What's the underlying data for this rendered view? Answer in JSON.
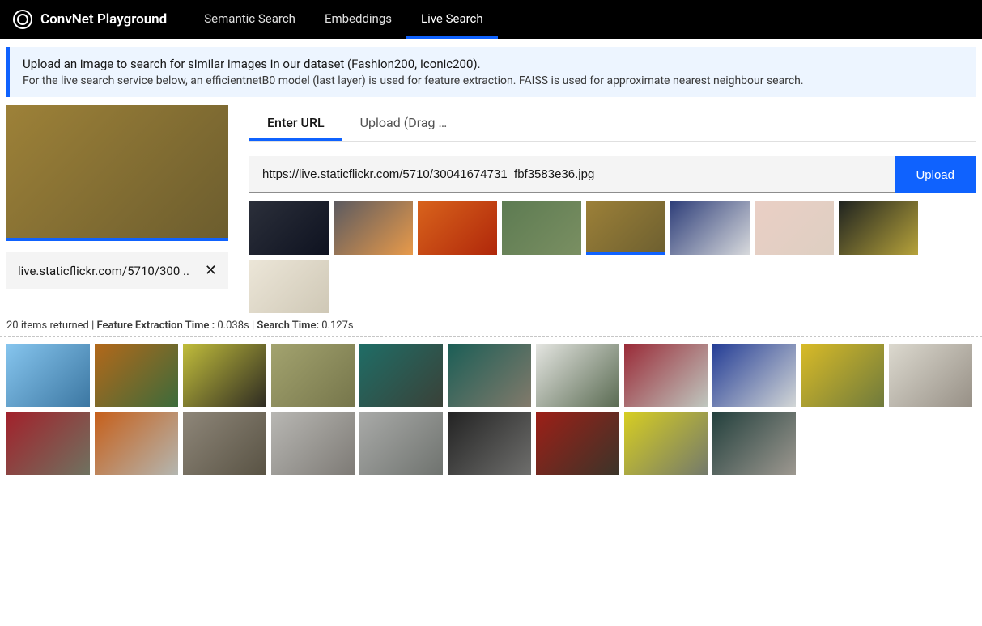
{
  "brand": "ConvNet Playground",
  "nav": {
    "items": [
      "Semantic Search",
      "Embeddings",
      "Live Search"
    ],
    "active_index": 2
  },
  "banner": {
    "line1": "Upload an image to search for similar images in our dataset (Fashion200, Iconic200).",
    "line2": "For the live search service below, an efficientnetB0 model (last layer) is used for feature extraction. FAISS is used for approximate nearest neighbour search."
  },
  "tabs": {
    "items": [
      "Enter URL",
      "Upload (Drag n Dr..."
    ],
    "active_index": 0
  },
  "url_input": {
    "value": "https://live.staticflickr.com/5710/30041674731_fbf3583e36.jpg",
    "button_label": "Upload"
  },
  "samples": [
    {
      "name": "eiffel-tower",
      "bg1": "#2b2f3a",
      "bg2": "#0e1220"
    },
    {
      "name": "stonehenge",
      "bg1": "#5b5a60",
      "bg2": "#e89a4a"
    },
    {
      "name": "orange-slices",
      "bg1": "#d8631c",
      "bg2": "#b0270a"
    },
    {
      "name": "red-car-road",
      "bg1": "#5d7b52",
      "bg2": "#7a8f62"
    },
    {
      "name": "vintage-car",
      "bg1": "#9c8038",
      "bg2": "#6e6030",
      "selected": true
    },
    {
      "name": "blue-dress",
      "bg1": "#2f3f7a",
      "bg2": "#d7d9dc"
    },
    {
      "name": "pink-flats",
      "bg1": "#eacfc5",
      "bg2": "#decfc2"
    },
    {
      "name": "black-sneakers",
      "bg1": "#1f2320",
      "bg2": "#b6a23a"
    },
    {
      "name": "grey-shoes",
      "bg1": "#ece6d8",
      "bg2": "#cfc8b6"
    }
  ],
  "query_image": {
    "name": "vintage-car",
    "bg1": "#9d8138",
    "bg2": "#6c5d2e"
  },
  "chip": {
    "text": "live.staticflickr.com/5710/300 .."
  },
  "stats": {
    "items_returned": "20 items returned",
    "extract_label": "Feature Extraction Time :",
    "extract_time": "0.038s",
    "search_label": "Search Time:",
    "search_time": "0.127s"
  },
  "results": [
    {
      "name": "blue-pickup-city",
      "bg1": "#86c5ee",
      "bg2": "#3c77a2"
    },
    {
      "name": "orange-beetle-park",
      "bg1": "#b3681a",
      "bg2": "#3c6b3b"
    },
    {
      "name": "yellow-beetle-show",
      "bg1": "#c1bd3b",
      "bg2": "#2e2b22"
    },
    {
      "name": "tan-beetle-field",
      "bg1": "#a3a36f",
      "bg2": "#76764b"
    },
    {
      "name": "teal-beetle-1",
      "bg1": "#1f6d66",
      "bg2": "#3a4138"
    },
    {
      "name": "teal-beetle-2",
      "bg1": "#1b5e56",
      "bg2": "#827a6b"
    },
    {
      "name": "white-pickup",
      "bg1": "#e4e5e1",
      "bg2": "#5a6b52"
    },
    {
      "name": "red-beetle",
      "bg1": "#9a2a37",
      "bg2": "#bfc7bf"
    },
    {
      "name": "blue-white-beetle",
      "bg1": "#243d96",
      "bg2": "#d2d6d6"
    },
    {
      "name": "yellow-beetle-grass",
      "bg1": "#d9bb27",
      "bg2": "#6f7a3c"
    },
    {
      "name": "white-beetle",
      "bg1": "#dcd9cf",
      "bg2": "#979086"
    },
    {
      "name": "red-beetle-street",
      "bg1": "#a2212b",
      "bg2": "#6f7260"
    },
    {
      "name": "orange-beetle-road",
      "bg1": "#c65f1a",
      "bg2": "#b4b6b0"
    },
    {
      "name": "grey-beetle-cobble",
      "bg1": "#8e8679",
      "bg2": "#595344"
    },
    {
      "name": "silver-sedan",
      "bg1": "#b8b7b3",
      "bg2": "#7e7b76"
    },
    {
      "name": "silver-pickup",
      "bg1": "#a9aaa8",
      "bg2": "#6f736f"
    },
    {
      "name": "black-car",
      "bg1": "#232323",
      "bg2": "#6e6e6c"
    },
    {
      "name": "red-pickup-house",
      "bg1": "#9d1f17",
      "bg2": "#3b3429"
    },
    {
      "name": "yellow-beetle-lot",
      "bg1": "#d7ce22",
      "bg2": "#747a6b"
    },
    {
      "name": "dark-teal-beetle",
      "bg1": "#23403d",
      "bg2": "#9d9890"
    }
  ]
}
